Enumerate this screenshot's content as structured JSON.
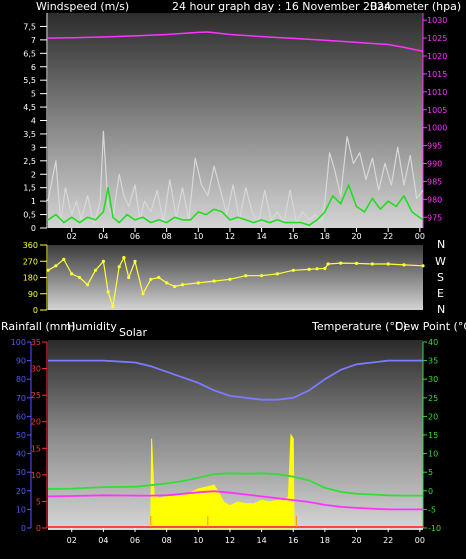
{
  "header": {
    "wind_title": "Windspeed (m/s)",
    "main_title": "24 hour graph day : 16 November 2024",
    "baro_title": "Barometer (hpa)"
  },
  "lower_header": {
    "rain_title": "Rainfall (mm)",
    "humidity_title": "Humidity",
    "solar_title": "Solar",
    "temp_title": "Temperature (°C)",
    "dew_title": "Dew Point (°C)"
  },
  "compass": [
    "N",
    "W",
    "S",
    "E",
    "N"
  ],
  "colors": {
    "wind_gust": "#d8d8d8",
    "wind_avg": "#22dd22",
    "barometer": "#ff33ff",
    "direction": "#ffff33",
    "humidity": "#7b7bff",
    "temperature": "#33dd33",
    "dew_point": "#ff33ff",
    "solar": "#ffff00",
    "rainfall": "#ff4444",
    "left_axis_wind": "#ffffff",
    "right_axis_baro": "#ff33ff",
    "left_axis_humidity": "#5555ff",
    "left_axis_rain": "#ff3333",
    "right_axis_temp": "#33dd33"
  },
  "chart_data": [
    {
      "type": "line",
      "title": "24 hour graph day : 16 November 2024",
      "x_tick_labels": [
        "02",
        "04",
        "06",
        "08",
        "10",
        "12",
        "14",
        "16",
        "18",
        "20",
        "22",
        "00"
      ],
      "x_range_hours": [
        0.5,
        24.2
      ],
      "y_left": {
        "label": "Windspeed (m/s)",
        "range": [
          0,
          8
        ],
        "ticks": [
          "0",
          "0,5",
          "1",
          "1,5",
          "2",
          "2,5",
          "3",
          "3,5",
          "4",
          "4,5",
          "5",
          "5,5",
          "6",
          "6,5",
          "7",
          "7,5"
        ]
      },
      "y_right": {
        "label": "Barometer (hpa)",
        "range": [
          972,
          1032
        ],
        "ticks": [
          "975",
          "980",
          "985",
          "990",
          "995",
          "1000",
          "1005",
          "1010",
          "1015",
          "1020",
          "1025",
          "1030"
        ]
      },
      "grid": false,
      "series": [
        {
          "name": "Barometer (hpa)",
          "axis": "right",
          "x": [
            0.5,
            2,
            4,
            6,
            8,
            10,
            10.6,
            12,
            14,
            16,
            18,
            20,
            22,
            23,
            24.2
          ],
          "y": [
            1025,
            1025.1,
            1025.3,
            1025.6,
            1026,
            1026.6,
            1026.7,
            1026,
            1025.4,
            1024.9,
            1024.4,
            1023.8,
            1023.2,
            1022.4,
            1021.3
          ]
        },
        {
          "name": "gust",
          "axis": "left",
          "x": [
            0.5,
            1,
            1.3,
            1.6,
            2,
            2.3,
            2.6,
            3,
            3.4,
            3.8,
            4,
            4.3,
            4.6,
            5,
            5.3,
            5.6,
            6,
            6.3,
            6.6,
            7,
            7.4,
            7.8,
            8.2,
            8.6,
            9,
            9.4,
            9.8,
            10.2,
            10.6,
            11,
            11.4,
            11.8,
            12.2,
            12.6,
            13,
            13.4,
            13.8,
            14.2,
            14.6,
            15,
            15.4,
            15.8,
            16.2,
            16.6,
            17,
            17.4,
            17.8,
            18,
            18.3,
            18.6,
            19,
            19.4,
            19.8,
            20.2,
            20.6,
            21,
            21.4,
            21.8,
            22.2,
            22.6,
            23,
            23.4,
            23.8,
            24.2
          ],
          "y": [
            1,
            2.5,
            0.2,
            1.5,
            0.5,
            1,
            0.3,
            1.2,
            0.1,
            1,
            3.6,
            0.8,
            0.4,
            2,
            1.2,
            0.8,
            1.6,
            0.3,
            1,
            0.6,
            1.4,
            0.2,
            1.8,
            0.4,
            1.5,
            0.3,
            2.6,
            1.6,
            1.2,
            2.3,
            1.4,
            0.5,
            1.6,
            0.3,
            1.5,
            0.6,
            0.2,
            1.4,
            0.3,
            0.6,
            0.2,
            1.4,
            0.2,
            0.6,
            0.3,
            0.5,
            0.2,
            1,
            2.8,
            2.2,
            1.2,
            3.4,
            2.4,
            2.8,
            1.8,
            2.6,
            1.4,
            2.4,
            1.6,
            3,
            1.6,
            2.7,
            1.1,
            1.4
          ]
        },
        {
          "name": "average",
          "axis": "left",
          "x": [
            0.5,
            1,
            1.5,
            2,
            2.5,
            3,
            3.5,
            4,
            4.3,
            4.6,
            5,
            5.5,
            6,
            6.5,
            7,
            7.5,
            8,
            8.5,
            9,
            9.5,
            10,
            10.5,
            11,
            11.5,
            12,
            12.5,
            13,
            13.5,
            14,
            14.5,
            15,
            15.5,
            16,
            16.5,
            17,
            17.5,
            18,
            18.5,
            19,
            19.5,
            20,
            20.5,
            21,
            21.5,
            22,
            22.5,
            23,
            23.5,
            24.2
          ],
          "y": [
            0.3,
            0.5,
            0.2,
            0.4,
            0.2,
            0.4,
            0.3,
            0.6,
            1.5,
            0.4,
            0.2,
            0.5,
            0.3,
            0.4,
            0.2,
            0.3,
            0.2,
            0.4,
            0.3,
            0.3,
            0.6,
            0.5,
            0.7,
            0.6,
            0.3,
            0.4,
            0.3,
            0.2,
            0.3,
            0.2,
            0.3,
            0.2,
            0.2,
            0.2,
            0.1,
            0.3,
            0.6,
            1.2,
            0.9,
            1.6,
            0.8,
            0.6,
            1.1,
            0.7,
            1,
            0.8,
            1.2,
            0.6,
            0.3
          ]
        }
      ]
    },
    {
      "type": "scatter",
      "y_ticks": [
        "360",
        "270",
        "180",
        "90",
        "0"
      ],
      "y_range": [
        0,
        360
      ],
      "series": [
        {
          "name": "Wind direction",
          "x": [
            0.5,
            1,
            1.5,
            2,
            2.5,
            3,
            3.5,
            4,
            4.3,
            4.6,
            5,
            5.3,
            5.6,
            6,
            6.5,
            7,
            7.5,
            8,
            8.5,
            9,
            10,
            11,
            12,
            13,
            14,
            15,
            16,
            17,
            17.5,
            18,
            18.2,
            19,
            20,
            21,
            22,
            23,
            24.2
          ],
          "y": [
            220,
            245,
            280,
            200,
            180,
            140,
            220,
            270,
            100,
            20,
            240,
            290,
            180,
            270,
            90,
            170,
            180,
            150,
            130,
            140,
            150,
            160,
            170,
            190,
            190,
            200,
            220,
            225,
            228,
            230,
            255,
            260,
            258,
            255,
            255,
            250,
            245
          ]
        }
      ]
    },
    {
      "type": "line",
      "x_tick_labels": [
        "02",
        "04",
        "06",
        "08",
        "10",
        "12",
        "14",
        "16",
        "18",
        "20",
        "22",
        "00"
      ],
      "y_left_humidity": {
        "label": "Humidity",
        "range": [
          0,
          100
        ],
        "ticks": [
          "0",
          "10",
          "20",
          "30",
          "40",
          "50",
          "60",
          "70",
          "80",
          "90",
          "100"
        ]
      },
      "y_left_rain": {
        "label": "Rainfall (mm)",
        "range": [
          0,
          35
        ],
        "ticks": [
          "0",
          "5",
          "10",
          "15",
          "20",
          "25",
          "30",
          "35"
        ]
      },
      "y_right_temp": {
        "label": "Temperature (°C)",
        "range": [
          -10,
          40
        ],
        "ticks": [
          "-10",
          "-5",
          "0",
          "5",
          "10",
          "15",
          "20",
          "25",
          "30",
          "35",
          "40"
        ]
      },
      "series": [
        {
          "name": "Humidity",
          "axis": "humidity",
          "x": [
            0.5,
            2,
            4,
            6,
            7,
            8,
            9,
            10,
            11,
            12,
            13,
            14,
            15,
            16,
            17,
            18,
            19,
            20,
            21,
            22,
            23,
            24.2
          ],
          "y": [
            90,
            90,
            90,
            89,
            87,
            84,
            81,
            78,
            74,
            71,
            70,
            69,
            69,
            70,
            74,
            80,
            85,
            88,
            89,
            90,
            90,
            90
          ]
        },
        {
          "name": "Temperature (°C)",
          "axis": "temp",
          "x": [
            0.5,
            2,
            4,
            6,
            7,
            8,
            9,
            10,
            11,
            12,
            13,
            14,
            15,
            16,
            17,
            18,
            19,
            20,
            21,
            22,
            23,
            24.2
          ],
          "y": [
            0.5,
            0.6,
            1,
            1.1,
            1.5,
            2,
            2.6,
            3.5,
            4.5,
            4.7,
            4.6,
            4.7,
            4.5,
            3.8,
            2.8,
            0.8,
            -0.3,
            -0.8,
            -1,
            -1.2,
            -1.3,
            -1.3
          ]
        },
        {
          "name": "Dew Point (°C)",
          "axis": "temp",
          "x": [
            0.5,
            2,
            4,
            6,
            7,
            8,
            9,
            10,
            11,
            12,
            13,
            14,
            15,
            16,
            17,
            18,
            19,
            20,
            21,
            22,
            23,
            24.2
          ],
          "y": [
            -1.5,
            -1.4,
            -1.2,
            -1.3,
            -1.3,
            -1.2,
            -0.8,
            -0.4,
            -0.1,
            -0.5,
            -1,
            -1.5,
            -2,
            -2.5,
            -3,
            -3.8,
            -4.3,
            -4.6,
            -4.8,
            -5,
            -5,
            -5
          ]
        },
        {
          "name": "Solar",
          "type": "area",
          "axis": "temp",
          "x": [
            7,
            7.05,
            7.2,
            7.5,
            8,
            8.5,
            9,
            9.5,
            10,
            10.5,
            11,
            11.3,
            11.6,
            12,
            12.5,
            13,
            13.5,
            14,
            14.5,
            15,
            15.5,
            15.7,
            15.85,
            16,
            16.05
          ],
          "y": [
            -10,
            14,
            -1,
            -2,
            -1.5,
            -1.5,
            -1,
            -0.5,
            0.5,
            1,
            1.5,
            -0.5,
            -3,
            -4,
            -3,
            -3.5,
            -3.5,
            -2.5,
            -3,
            -2.5,
            -2.8,
            -1.5,
            15,
            14,
            -10
          ]
        },
        {
          "name": "Rainfall (mm)",
          "axis": "rain",
          "x": [
            0.5,
            24.2
          ],
          "y": [
            0,
            0
          ]
        }
      ]
    }
  ]
}
